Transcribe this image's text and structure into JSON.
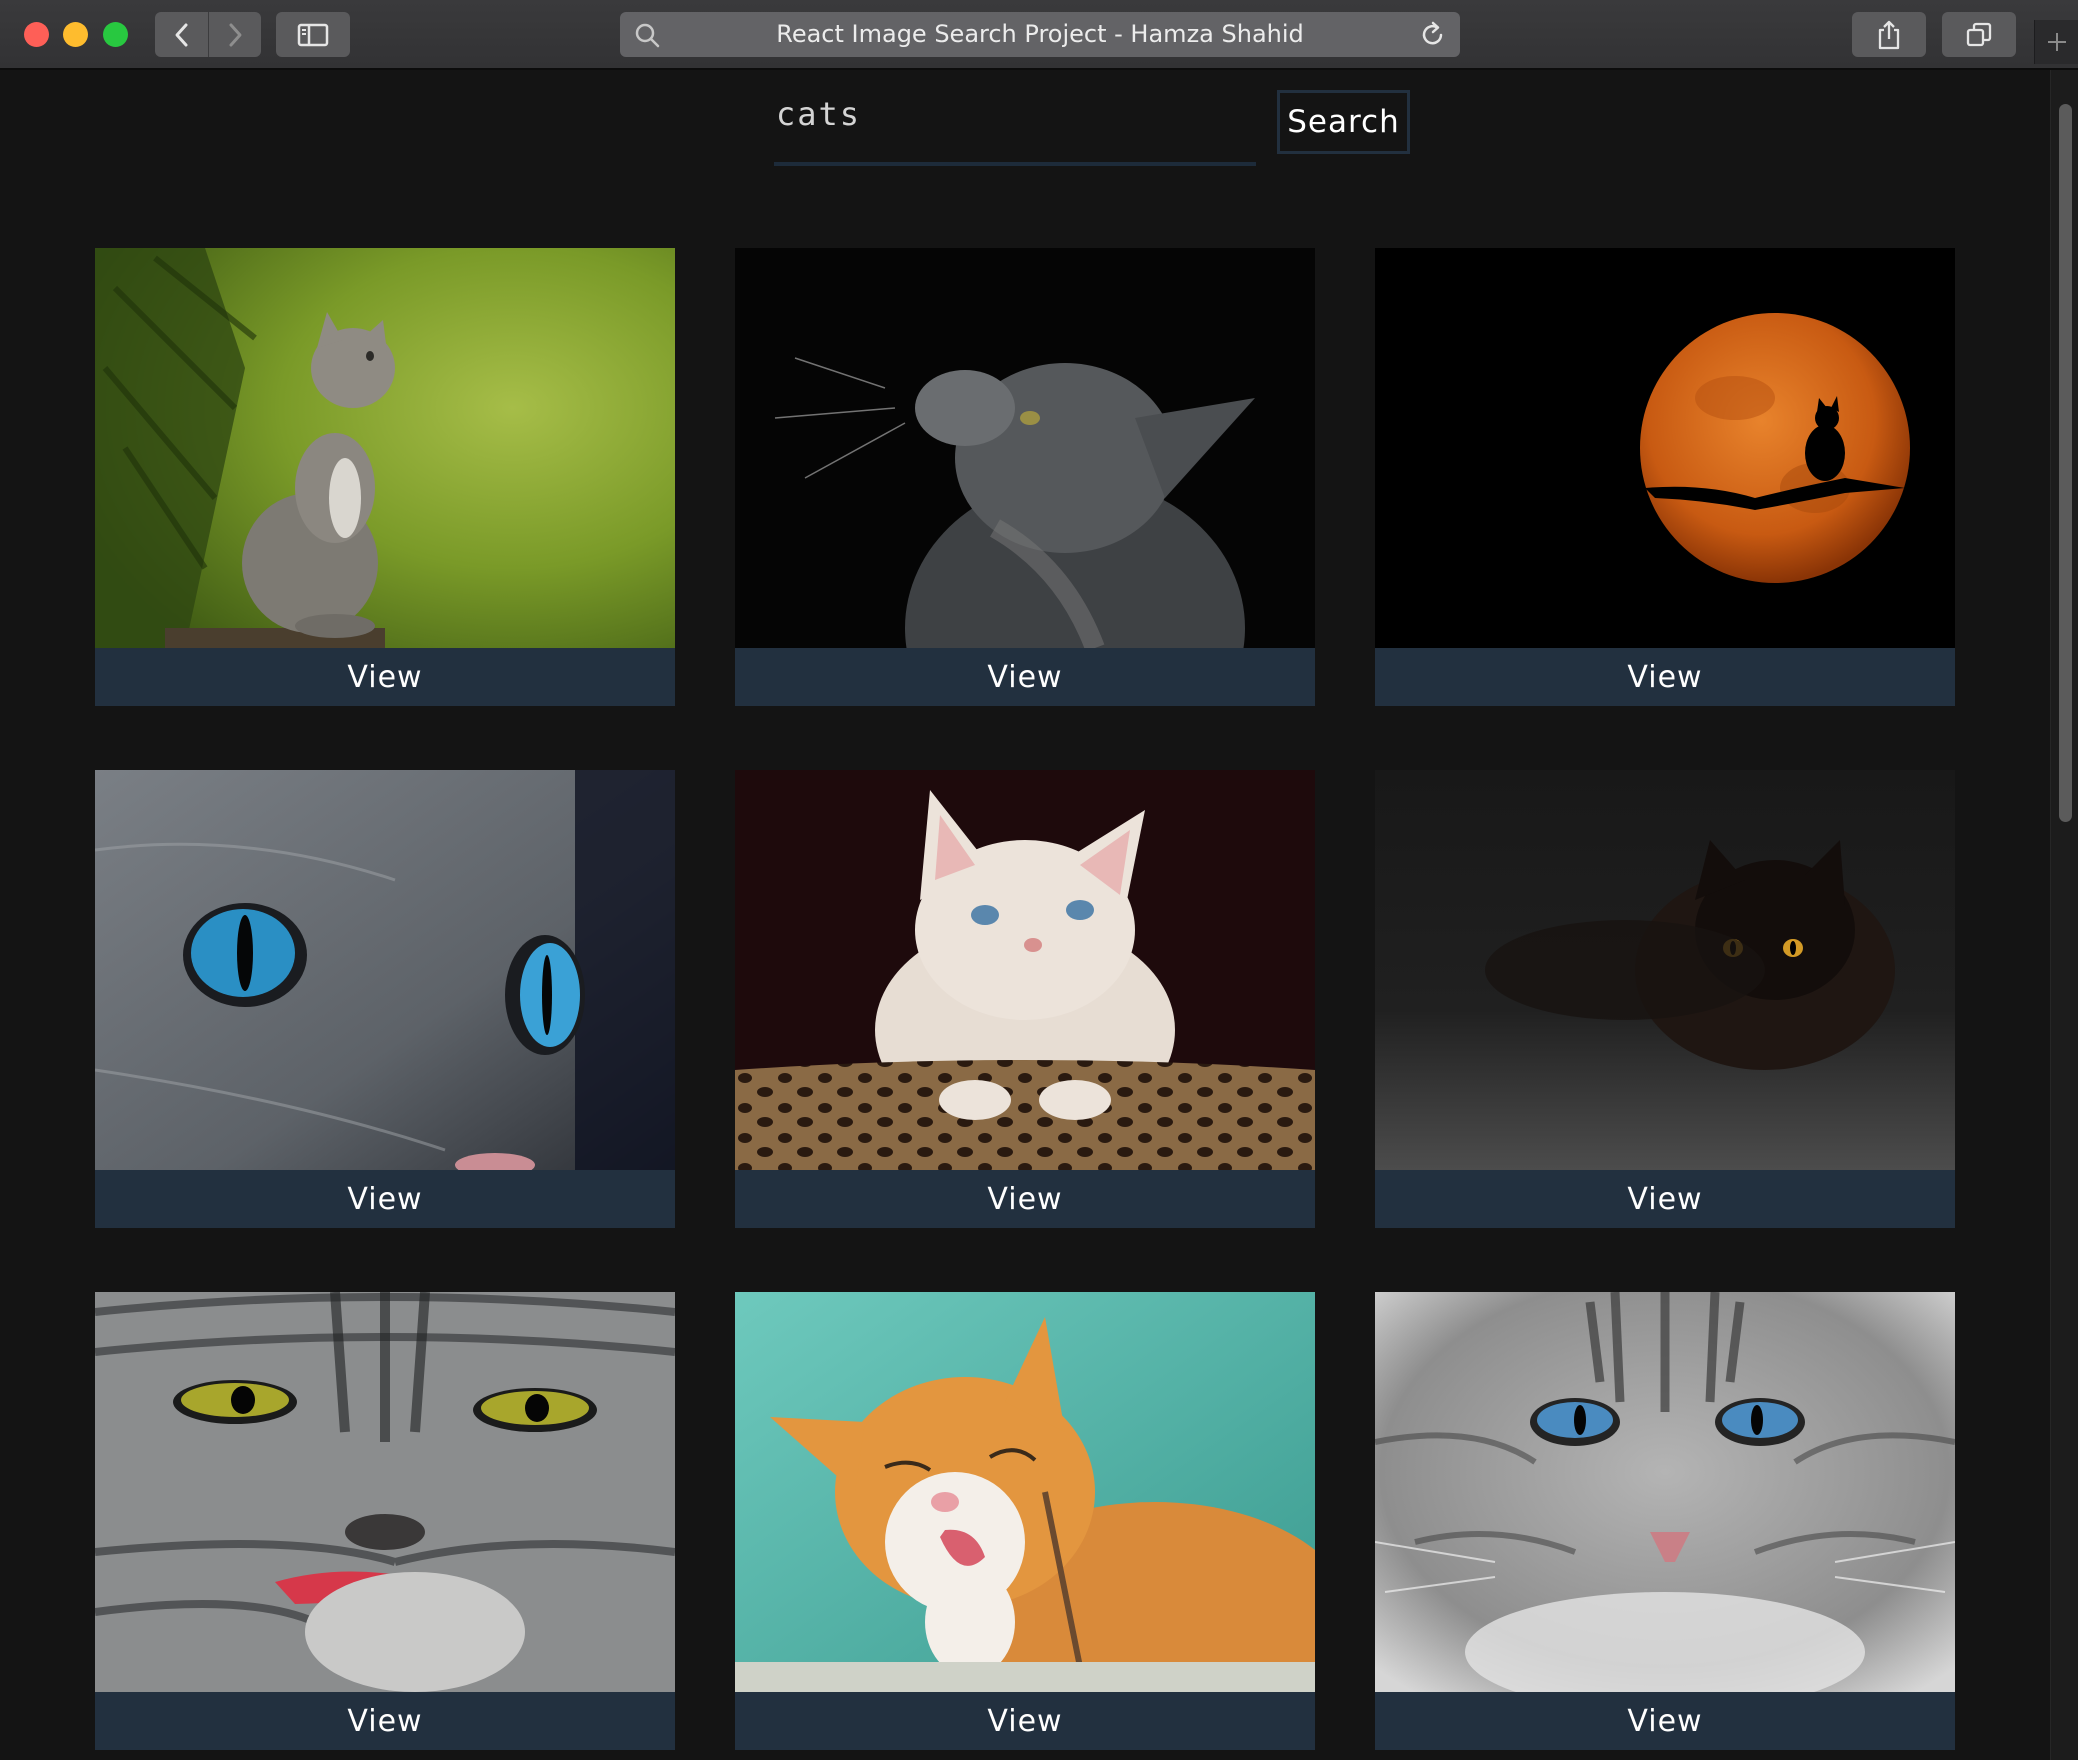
{
  "browser": {
    "address_title": "React Image Search Project - Hamza Shahid",
    "icons": {
      "back": "chevron-left-icon",
      "forward": "chevron-right-icon",
      "sidebar": "sidebar-icon",
      "search": "magnifier-icon",
      "reload": "reload-icon",
      "share": "share-icon",
      "tabs": "tabs-overview-icon",
      "new_tab": "plus-icon"
    }
  },
  "search": {
    "query": "cats",
    "button_label": "Search"
  },
  "results": [
    {
      "alt": "grey kitten sitting in front of green foliage",
      "button_label": "View"
    },
    {
      "alt": "grey fluffy cat looking up on black background",
      "button_label": "View"
    },
    {
      "alt": "cat silhouette on a branch in front of an orange moon",
      "button_label": "View"
    },
    {
      "alt": "close-up of cat face with blue eyes",
      "button_label": "View"
    },
    {
      "alt": "cream kitten resting on leopard print bed",
      "button_label": "View"
    },
    {
      "alt": "black cat with orange eyes in the dark",
      "button_label": "View"
    },
    {
      "alt": "tabby cat with yellow eyes licking paw",
      "button_label": "View"
    },
    {
      "alt": "orange and white cat licking paw in front of teal wall",
      "button_label": "View"
    },
    {
      "alt": "grey tabby cat with blue eyes",
      "button_label": "View"
    }
  ],
  "colors": {
    "page_background": "#141414",
    "button_background": "#22303f",
    "button_text": "#ffffff"
  }
}
